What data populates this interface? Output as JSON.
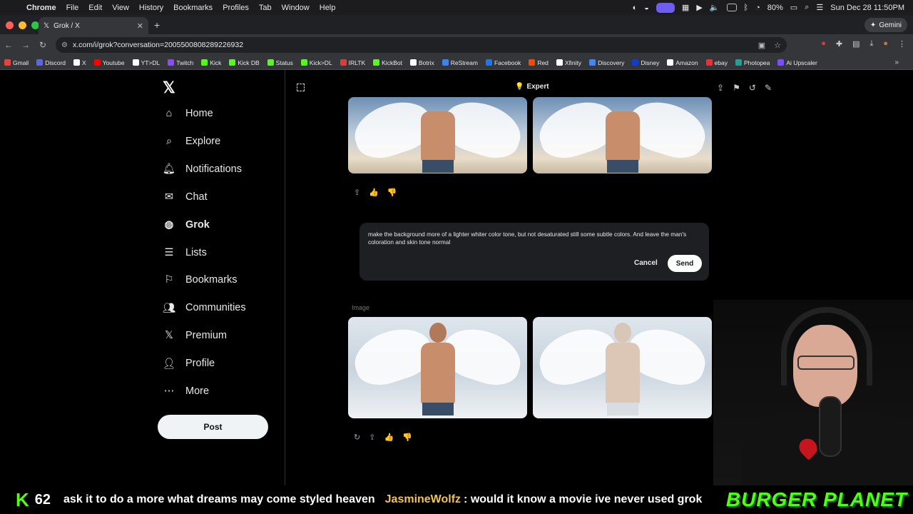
{
  "menubar": {
    "app": "Chrome",
    "items": [
      "File",
      "Edit",
      "View",
      "History",
      "Bookmarks",
      "Profiles",
      "Tab",
      "Window",
      "Help"
    ],
    "battery": "80%",
    "datetime": "Sun Dec 28  11:50PM"
  },
  "browser": {
    "tab_title": "Grok / X",
    "url": "x.com/i/grok?conversation=2005500808289226932",
    "gemini_label": "Gemini",
    "bookmarks": [
      {
        "label": "Gmail",
        "color": "#ea4335"
      },
      {
        "label": "Discord",
        "color": "#5865f2"
      },
      {
        "label": "X",
        "color": "#ffffff"
      },
      {
        "label": "Youtube",
        "color": "#ff0000"
      },
      {
        "label": "YT>DL",
        "color": "#ffffff"
      },
      {
        "label": "Twitch",
        "color": "#9146ff"
      },
      {
        "label": "Kick",
        "color": "#53fc18"
      },
      {
        "label": "Kick DB",
        "color": "#53fc18"
      },
      {
        "label": "Status",
        "color": "#53fc18"
      },
      {
        "label": "Kick>DL",
        "color": "#53fc18"
      },
      {
        "label": "IRLTK",
        "color": "#e53935"
      },
      {
        "label": "KickBot",
        "color": "#53fc18"
      },
      {
        "label": "Botrix",
        "color": "#ffffff"
      },
      {
        "label": "ReStream",
        "color": "#3b82f6"
      },
      {
        "label": "Facebook",
        "color": "#1877f2"
      },
      {
        "label": "Red",
        "color": "#ff4500"
      },
      {
        "label": "Xfinity",
        "color": "#ffffff"
      },
      {
        "label": "Discovery",
        "color": "#4285f4"
      },
      {
        "label": "Disney",
        "color": "#113ccf"
      },
      {
        "label": "Amazon",
        "color": "#ffffff"
      },
      {
        "label": "ebay",
        "color": "#e53238"
      },
      {
        "label": "Photopea",
        "color": "#18a497"
      },
      {
        "label": "Ai Upscaler",
        "color": "#7c4dff"
      }
    ]
  },
  "sidebar": {
    "items": [
      {
        "label": "Home",
        "icon": "home-icon"
      },
      {
        "label": "Explore",
        "icon": "search-icon"
      },
      {
        "label": "Notifications",
        "icon": "bell-icon"
      },
      {
        "label": "Chat",
        "icon": "mail-icon"
      },
      {
        "label": "Grok",
        "icon": "grok-icon"
      },
      {
        "label": "Lists",
        "icon": "list-icon"
      },
      {
        "label": "Bookmarks",
        "icon": "bookmark-icon"
      },
      {
        "label": "Communities",
        "icon": "people-icon"
      },
      {
        "label": "Premium",
        "icon": "x-icon"
      },
      {
        "label": "Profile",
        "icon": "person-icon"
      },
      {
        "label": "More",
        "icon": "more-icon"
      }
    ],
    "post_label": "Post"
  },
  "grok": {
    "mode": "Expert",
    "prompt_text": "make the background more of a lighter whiter color tone, but not desaturated still some subtle colors. And leave the man's coloration and skin tone normal",
    "cancel_label": "Cancel",
    "send_label": "Send",
    "image_label": "Image"
  },
  "ticker": {
    "count": "62",
    "message": "ask it to do a more what dreams may come styled heaven",
    "user": "JasmineWolfz",
    "user_message": ": would it know a movie ive never used grok",
    "brand": "BURGER PLANET"
  }
}
